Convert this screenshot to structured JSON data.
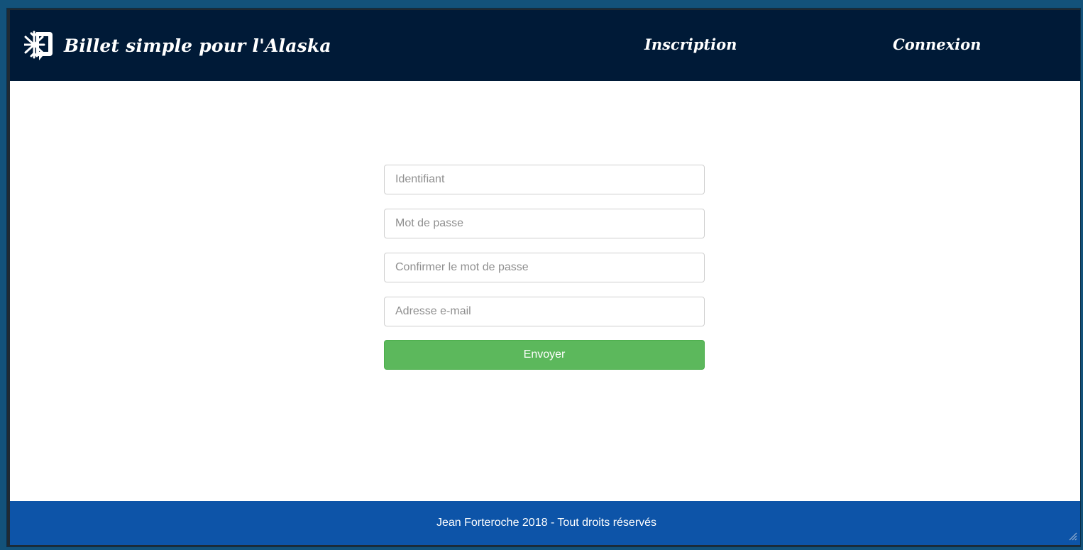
{
  "colors": {
    "navbar_bg": "#001a37",
    "footer_bg": "#0d54a8",
    "button_bg": "#5cb85c",
    "outer_bg": "#13527a"
  },
  "header": {
    "brand_icon": "snowflake-ticket-icon",
    "brand_title": "Billet simple pour l'Alaska",
    "nav": [
      {
        "label": "Inscription"
      },
      {
        "label": "Connexion"
      }
    ]
  },
  "form": {
    "fields": [
      {
        "placeholder": "Identifiant",
        "value": ""
      },
      {
        "placeholder": "Mot de passe",
        "value": ""
      },
      {
        "placeholder": "Confirmer le mot de passe",
        "value": ""
      },
      {
        "placeholder": "Adresse e-mail",
        "value": ""
      }
    ],
    "submit_label": "Envoyer"
  },
  "footer": {
    "text": "Jean Forteroche 2018 - Tout droits réservés"
  }
}
